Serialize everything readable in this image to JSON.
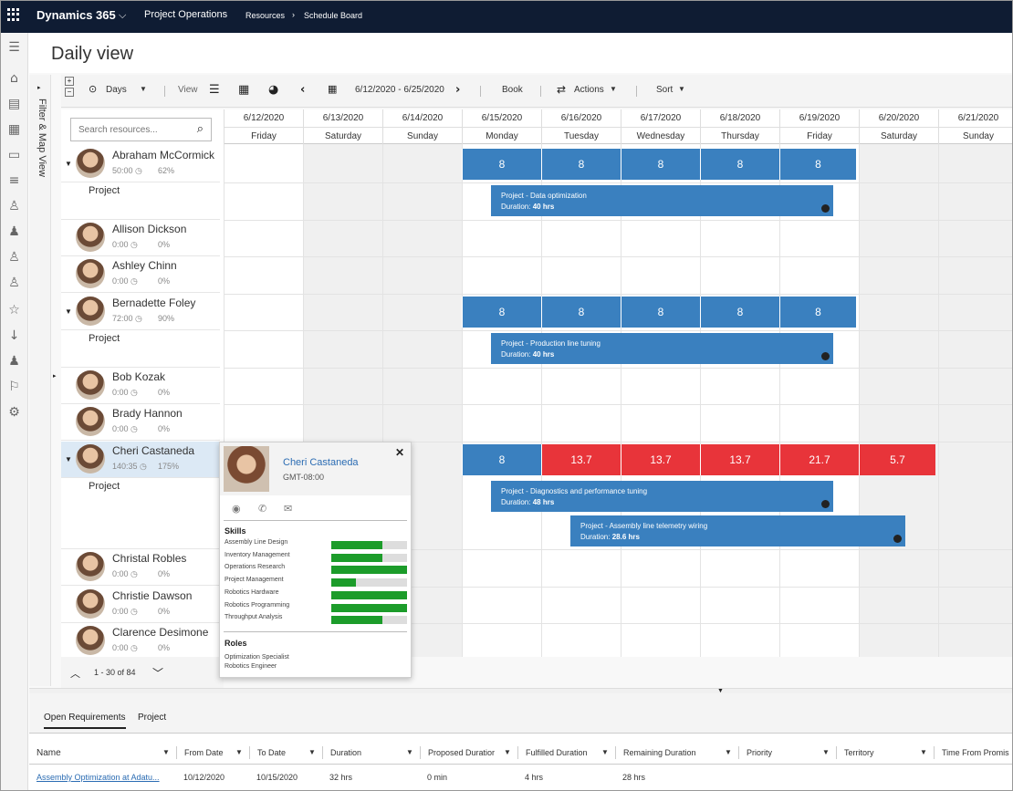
{
  "topbar": {
    "app_name": "Dynamics 365",
    "module": "Project Operations",
    "breadcrumb": [
      "Resources",
      "Schedule Board"
    ]
  },
  "page_title": "Daily view",
  "filter_panel_label": "Filter & Map View",
  "toolbar": {
    "days_label": "Days",
    "view_label": "View",
    "date_range": "6/12/2020 - 6/25/2020",
    "book_label": "Book",
    "actions_label": "Actions",
    "sort_label": "Sort"
  },
  "search": {
    "placeholder": "Search resources..."
  },
  "days": [
    {
      "date": "6/12/2020",
      "weekday": "Friday"
    },
    {
      "date": "6/13/2020",
      "weekday": "Saturday"
    },
    {
      "date": "6/14/2020",
      "weekday": "Sunday"
    },
    {
      "date": "6/15/2020",
      "weekday": "Monday"
    },
    {
      "date": "6/16/2020",
      "weekday": "Tuesday"
    },
    {
      "date": "6/17/2020",
      "weekday": "Wednesday"
    },
    {
      "date": "6/18/2020",
      "weekday": "Thursday"
    },
    {
      "date": "6/19/2020",
      "weekday": "Friday"
    },
    {
      "date": "6/20/2020",
      "weekday": "Saturday"
    },
    {
      "date": "6/21/2020",
      "weekday": "Sunday"
    }
  ],
  "resources": [
    {
      "name": "Abraham McCormick",
      "hours": "50:00",
      "pct": "62%"
    },
    {
      "name": "Allison Dickson",
      "hours": "0:00",
      "pct": "0%"
    },
    {
      "name": "Ashley Chinn",
      "hours": "0:00",
      "pct": "0%"
    },
    {
      "name": "Bernadette Foley",
      "hours": "72:00",
      "pct": "90%"
    },
    {
      "name": "Bob Kozak",
      "hours": "0:00",
      "pct": "0%"
    },
    {
      "name": "Brady Hannon",
      "hours": "0:00",
      "pct": "0%"
    },
    {
      "name": "Cheri Castaneda",
      "hours": "140:35",
      "pct": "175%"
    },
    {
      "name": "Christal Robles",
      "hours": "0:00",
      "pct": "0%"
    },
    {
      "name": "Christie Dawson",
      "hours": "0:00",
      "pct": "0%"
    },
    {
      "name": "Clarence Desimone",
      "hours": "0:00",
      "pct": "0%"
    }
  ],
  "project_label": "Project",
  "capacity": {
    "abraham": [
      "8",
      "8",
      "8",
      "8",
      "8"
    ],
    "bernadette": [
      "8",
      "8",
      "8",
      "8",
      "8"
    ],
    "cheri": [
      "8",
      "13.7",
      "13.7",
      "13.7",
      "21.7",
      "5.7"
    ]
  },
  "bookings": [
    {
      "title": "Project - Data optimization",
      "duration_label": "Duration:",
      "duration": "40 hrs"
    },
    {
      "title": "Project - Production line tuning",
      "duration_label": "Duration:",
      "duration": "40 hrs"
    },
    {
      "title": "Project - Diagnostics and performance tuning",
      "duration_label": "Duration:",
      "duration": "48 hrs"
    },
    {
      "title": "Project - Assembly line telemetry wiring",
      "duration_label": "Duration:",
      "duration": "28.6 hrs"
    }
  ],
  "pager": {
    "text": "1 - 30 of 84"
  },
  "card": {
    "name": "Cheri Castaneda",
    "timezone": "GMT-08:00",
    "skills_header": "Skills",
    "skills": [
      {
        "name": "Assembly Line Design",
        "level": 0.67
      },
      {
        "name": "Inventory Management",
        "level": 0.67
      },
      {
        "name": "Operations Research",
        "level": 1.0
      },
      {
        "name": "Project Management",
        "level": 0.33
      },
      {
        "name": "Robotics Hardware",
        "level": 1.0
      },
      {
        "name": "Robotics Programming",
        "level": 1.0
      },
      {
        "name": "Throughput Analysis",
        "level": 0.67
      }
    ],
    "roles_header": "Roles",
    "roles": [
      "Optimization Specialist",
      "Robotics Engineer"
    ]
  },
  "requirements": {
    "tabs": [
      "Open Requirements",
      "Project"
    ],
    "columns": [
      "Name",
      "From Date",
      "To Date",
      "Duration",
      "Proposed Duratior",
      "Fulfilled Duration",
      "Remaining Duration",
      "Priority",
      "Territory",
      "Time From Promis"
    ],
    "row": {
      "name": "Assembly Optimization at Adatu...",
      "from_date": "10/12/2020",
      "to_date": "10/15/2020",
      "duration": "32 hrs",
      "proposed": "0 min",
      "fulfilled": "4 hrs",
      "remaining": "28 hrs"
    }
  },
  "colors": {
    "topbar": "#0f1c33",
    "booking": "#3a80bf",
    "overbooked": "#e8343a",
    "skill": "#1c9c2a"
  }
}
